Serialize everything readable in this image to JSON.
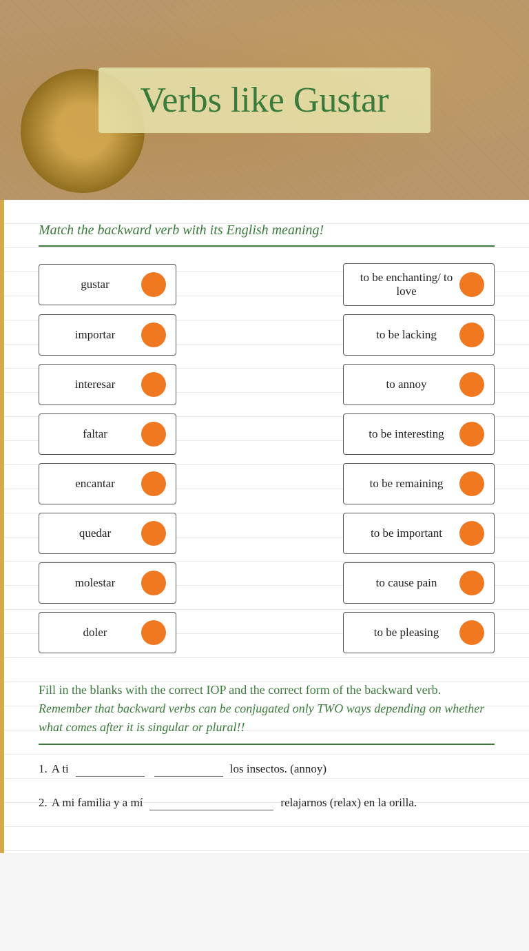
{
  "hero": {
    "title": "Verbs like Gustar"
  },
  "section1": {
    "instruction": "Match the backward verb with its English meaning!"
  },
  "verbs": [
    {
      "spanish": "gustar",
      "english": "to be enchanting/ to love"
    },
    {
      "spanish": "importar",
      "english": "to be lacking"
    },
    {
      "spanish": "interesar",
      "english": "to annoy"
    },
    {
      "spanish": "faltar",
      "english": "to be interesting"
    },
    {
      "spanish": "encantar",
      "english": "to be remaining"
    },
    {
      "spanish": "quedar",
      "english": "to be important"
    },
    {
      "spanish": "molestar",
      "english": "to cause pain"
    },
    {
      "spanish": "doler",
      "english": "to be pleasing"
    }
  ],
  "section2": {
    "instruction_main": "Fill in the blanks with the correct IOP and the correct form of the backward verb.",
    "instruction_italic": "Remember that backward verbs can be conjugated only TWO ways depending on whether what comes after it is singular or plural!!",
    "items": [
      {
        "number": "1.",
        "text_before": "A ti",
        "blank1": true,
        "blank2": true,
        "text_after": "los insectos. (annoy)"
      },
      {
        "number": "2.",
        "text_before": "A mi familia y a mí",
        "blank_wide": true,
        "text_after": "relajarnos (relax) en la orilla."
      }
    ]
  }
}
